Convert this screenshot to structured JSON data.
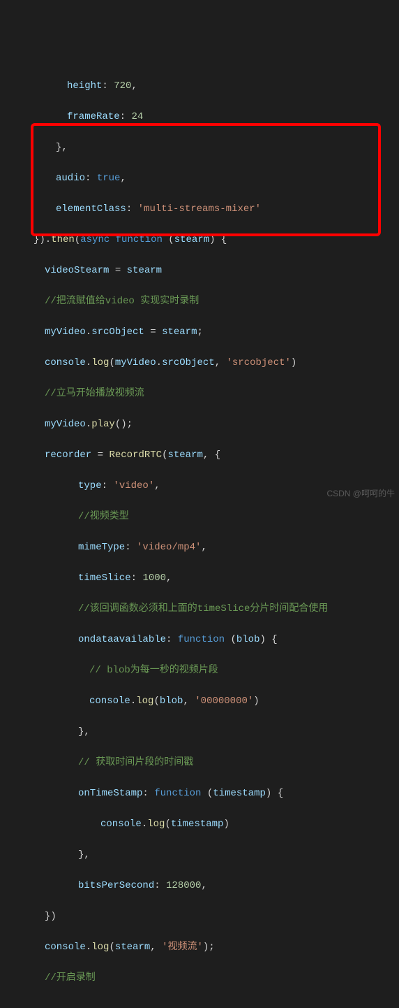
{
  "code": {
    "l01a": "height",
    "l01b": ": ",
    "l01c": "720",
    "l01d": ",",
    "l02a": "frameRate",
    "l02b": ": ",
    "l02c": "24",
    "l03": "},",
    "l04a": "audio",
    "l04b": ": ",
    "l04c": "true",
    "l04d": ",",
    "l05a": "elementClass",
    "l05b": ": ",
    "l05c": "'multi-streams-mixer'",
    "l06a": "}).",
    "l06b": "then",
    "l06c": "(",
    "l06d": "async",
    "l06e": " ",
    "l06f": "function",
    "l06g": " (",
    "l06h": "stearm",
    "l06i": ") {",
    "l07a": "videoStearm",
    "l07b": " = ",
    "l07c": "stearm",
    "l08": "//把流赋值给video 实现实时录制",
    "l09a": "myVideo",
    "l09b": ".",
    "l09c": "srcObject",
    "l09d": " = ",
    "l09e": "stearm",
    "l09f": ";",
    "l10a": "console",
    "l10b": ".",
    "l10c": "log",
    "l10d": "(",
    "l10e": "myVideo",
    "l10f": ".",
    "l10g": "srcObject",
    "l10h": ", ",
    "l10i": "'srcobject'",
    "l10j": ")",
    "l11": "//立马开始播放视频流",
    "l12a": "myVideo",
    "l12b": ".",
    "l12c": "play",
    "l12d": "();",
    "l13a": "recorder",
    "l13b": " = ",
    "l13c": "RecordRTC",
    "l13d": "(",
    "l13e": "stearm",
    "l13f": ", {",
    "l14a": "type",
    "l14b": ": ",
    "l14c": "'video'",
    "l14d": ",",
    "l15": "//视频类型",
    "l16a": "mimeType",
    "l16b": ": ",
    "l16c": "'video/mp4'",
    "l16d": ",",
    "l17a": "timeSlice",
    "l17b": ": ",
    "l17c": "1000",
    "l17d": ",",
    "l18": "//该回调函数必须和上面的timeSlice分片时间配合使用",
    "l19a": "ondataavailable",
    "l19b": ": ",
    "l19c": "function",
    "l19d": " (",
    "l19e": "blob",
    "l19f": ") {",
    "l20": "// blob为每一秒的视频片段",
    "l21a": "console",
    "l21b": ".",
    "l21c": "log",
    "l21d": "(",
    "l21e": "blob",
    "l21f": ", ",
    "l21g": "'00000000'",
    "l21h": ")",
    "l22": "},",
    "l23": "// 获取时间片段的时间戳",
    "l24a": "onTimeStamp",
    "l24b": ": ",
    "l24c": "function",
    "l24d": " (",
    "l24e": "timestamp",
    "l24f": ") {",
    "l25a": "console",
    "l25b": ".",
    "l25c": "log",
    "l25d": "(",
    "l25e": "timestamp",
    "l25f": ")",
    "l26": "},",
    "l27a": "bitsPerSecond",
    "l27b": ": ",
    "l27c": "128000",
    "l27d": ",",
    "l28": "})",
    "l29a": "console",
    "l29b": ".",
    "l29c": "log",
    "l29d": "(",
    "l29e": "stearm",
    "l29f": ", ",
    "l29g": "'视频流'",
    "l29h": ");",
    "l30": "//开启录制"
  },
  "watermark": "CSDN @呵呵的牛"
}
